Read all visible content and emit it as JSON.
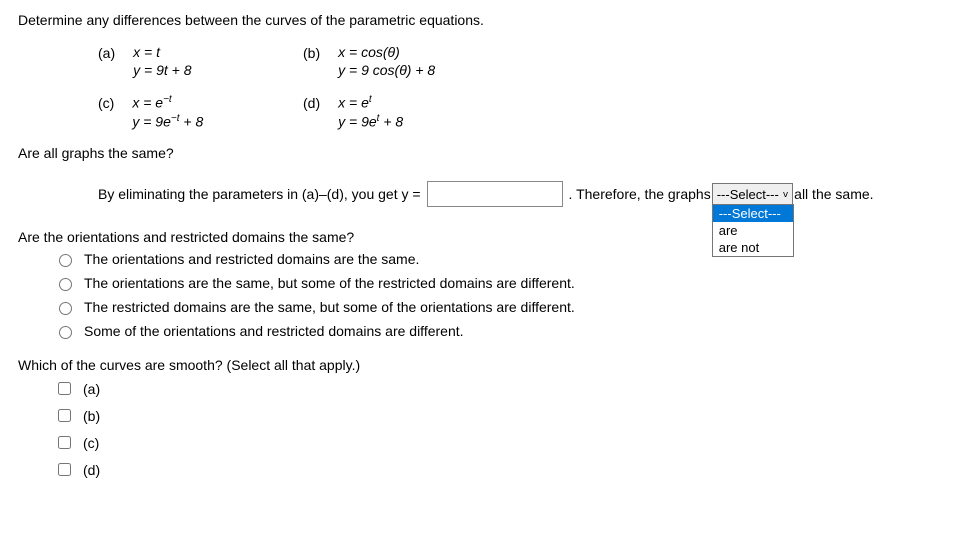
{
  "problem_statement": "Determine any differences between the curves of the parametric equations.",
  "equations": {
    "a": {
      "label": "(a)",
      "line1": "x = t",
      "line2": "y = 9t + 8"
    },
    "b": {
      "label": "(b)",
      "line1": "x = cos(θ)",
      "line2": "y = 9 cos(θ) + 8"
    },
    "c": {
      "label": "(c)",
      "line1_prefix": "x = e",
      "line1_sup": "−t",
      "line2_prefix": "y = 9e",
      "line2_sup": "−t",
      "line2_suffix": " + 8"
    },
    "d": {
      "label": "(d)",
      "line1_prefix": "x = e",
      "line1_sup": "t",
      "line2_prefix": "y = 9e",
      "line2_sup": "t",
      "line2_suffix": " + 8"
    }
  },
  "q1": "Are all graphs the same?",
  "fill": {
    "prefix": "By eliminating the parameters in (a)–(d), you get y = ",
    "mid": " . Therefore, the graphs ",
    "suffix": " all the same."
  },
  "select": {
    "placeholder": "---Select---",
    "options": [
      "---Select---",
      "are",
      "are not"
    ]
  },
  "q2": "Are the orientations and restricted domains the same?",
  "radio_options": [
    "The orientations and restricted domains are the same.",
    "The orientations are the same, but some of the restricted domains are different.",
    "The restricted domains are the same, but some of the orientations are different.",
    "Some of the orientations and restricted domains are different."
  ],
  "q3": "Which of the curves are smooth? (Select all that apply.)",
  "check_options": [
    "(a)",
    "(b)",
    "(c)",
    "(d)"
  ]
}
